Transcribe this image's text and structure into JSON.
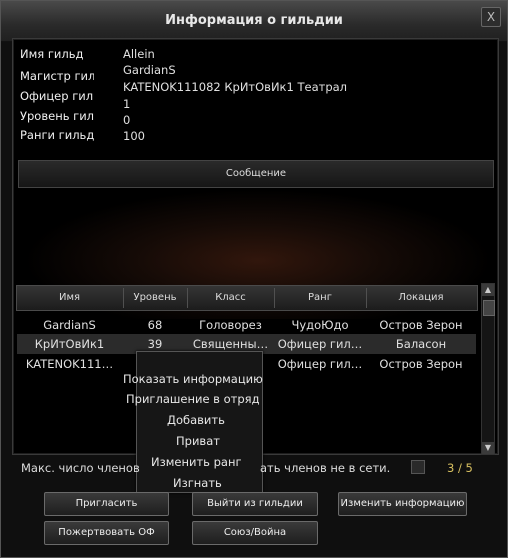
{
  "window": {
    "title": "Информация о гильдии",
    "close_label": "X"
  },
  "info": [
    {
      "label": "Имя гильд",
      "value": "Allein"
    },
    {
      "label": "",
      "value": "GardianS"
    },
    {
      "label": "Магистр гиль",
      "value": ""
    },
    {
      "label": "Офицер гилі",
      "value": "KATENOK111082  КрИтОвИк1   Театрал"
    },
    {
      "label": "",
      "value": "1"
    },
    {
      "label": "Уровень гилі",
      "value": "0"
    },
    {
      "label": "Ранги гильд",
      "value": "100"
    }
  ],
  "message_button": "Сообщение",
  "table": {
    "headers": [
      "Имя",
      "Уровень",
      "Класс",
      "Ранг",
      "Локация"
    ],
    "rows": [
      [
        "GardianS",
        "68",
        "Головорез",
        "ЧудоЮдо",
        "Остров Зерон"
      ],
      [
        "КрИтОвИк1",
        "39",
        "Священны…",
        "Офицер гил…",
        "Баласон"
      ],
      [
        "KATENOK111…",
        "",
        "",
        "Офицер гил…",
        "Остров Зерон"
      ]
    ]
  },
  "context_menu": [
    "Показать информацию",
    "Приглашение в отряд",
    "Добавить",
    "Приват",
    "Изменить ранг",
    "Изгнать"
  ],
  "footer": {
    "left_text": "Макс. число членов",
    "right_text": "ать членов не в сети.",
    "count": "3 / 5"
  },
  "buttons": {
    "invite": "Пригласить",
    "leave": "Выйти из гильдии",
    "edit_info": "Изменить информацию",
    "donate": "Пожертвовать ОФ",
    "alliance": "Союз/Война"
  },
  "scrollbar": {
    "up_icon": "▲",
    "down_icon": "▼"
  }
}
